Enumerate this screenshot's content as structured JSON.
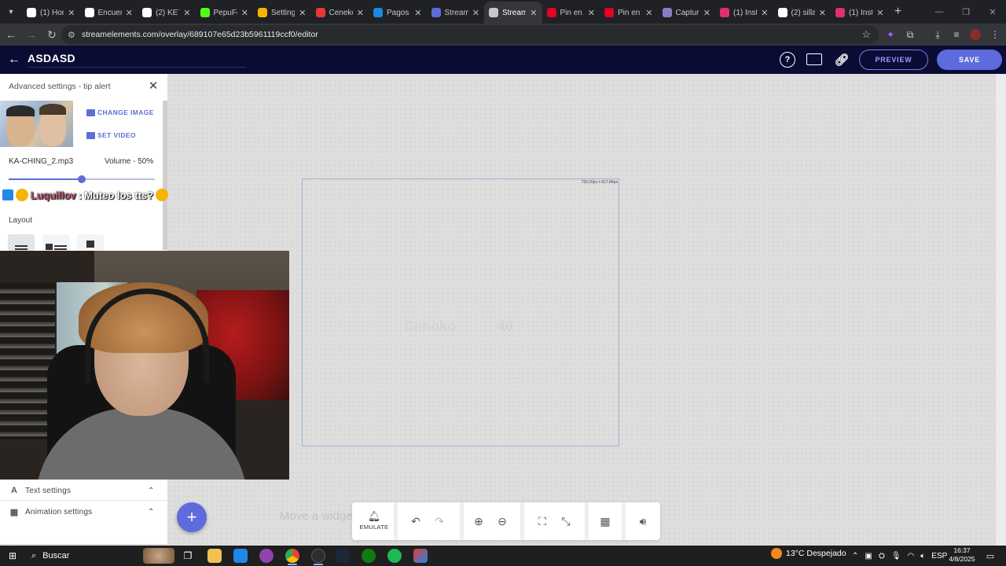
{
  "browser": {
    "tabs": [
      {
        "label": "(1) Hom",
        "icon": "x-twitter-icon",
        "color": "#ffffff"
      },
      {
        "label": "Encuen",
        "icon": "tiktok-icon",
        "color": "#ffffff"
      },
      {
        "label": "(2) KET",
        "icon": "x-twitter-icon",
        "color": "#ffffff"
      },
      {
        "label": "PepuFo",
        "icon": "kick-icon",
        "color": "#53fc18"
      },
      {
        "label": "Setting",
        "icon": "settings-icon",
        "color": "#f4b400"
      },
      {
        "label": "Ceneko",
        "icon": "c-icon",
        "color": "#e53935"
      },
      {
        "label": "Pagos c",
        "icon": "pagos-icon",
        "color": "#1e88e5"
      },
      {
        "label": "Stream",
        "icon": "streamelements-icon",
        "color": "#5d6bdc"
      },
      {
        "label": "Stream",
        "icon": "streamelements-icon",
        "color": "#c8c8c8",
        "active": true
      },
      {
        "label": "Pin en !",
        "icon": "pinterest-icon",
        "color": "#e60023"
      },
      {
        "label": "Pin en",
        "icon": "pinterest-icon",
        "color": "#e60023"
      },
      {
        "label": "Captur",
        "icon": "capture-icon",
        "color": "#8e7cc3"
      },
      {
        "label": "(1) Inst",
        "icon": "instagram-icon",
        "color": "#e1306c"
      },
      {
        "label": "(2) silla",
        "icon": "x-twitter-icon",
        "color": "#ffffff"
      },
      {
        "label": "(1) Inst",
        "icon": "instagram-icon",
        "color": "#e1306c"
      }
    ],
    "url": "streamelements.com/overlay/689107e65d23b5961119ccf0/editor"
  },
  "header": {
    "title": "ASDASD",
    "preview_label": "PREVIEW",
    "save_label": "SAVE"
  },
  "panel": {
    "title": "Advanced settings - tip alert",
    "change_image_label": "CHANGE IMAGE",
    "set_video_label": "SET VIDEO",
    "sound_file": "KA-CHING_2.mp3",
    "volume_label": "Volume - 50%",
    "volume": 0.5,
    "layout_label": "Layout",
    "text_settings_label": "Text settings",
    "animation_settings_label": "Animation settings"
  },
  "chat": {
    "user": "Luquillov",
    "separator": ":",
    "message": "Muteo los tts?"
  },
  "canvas": {
    "widget_dimensions": "733.20px x 617.84px",
    "ghost_text": "Cenoko",
    "ghost_number": "40",
    "move_hint": "Move a widget"
  },
  "toolbar": {
    "emulate_label": "EMULATE"
  },
  "taskbar": {
    "search_label": "Buscar",
    "weather": "13°C  Despejado",
    "language": "ESP",
    "time": "16:37",
    "date": "4/8/2025"
  },
  "colors": {
    "accent": "#5d6bdc",
    "header_bg": "#0b0c34"
  }
}
